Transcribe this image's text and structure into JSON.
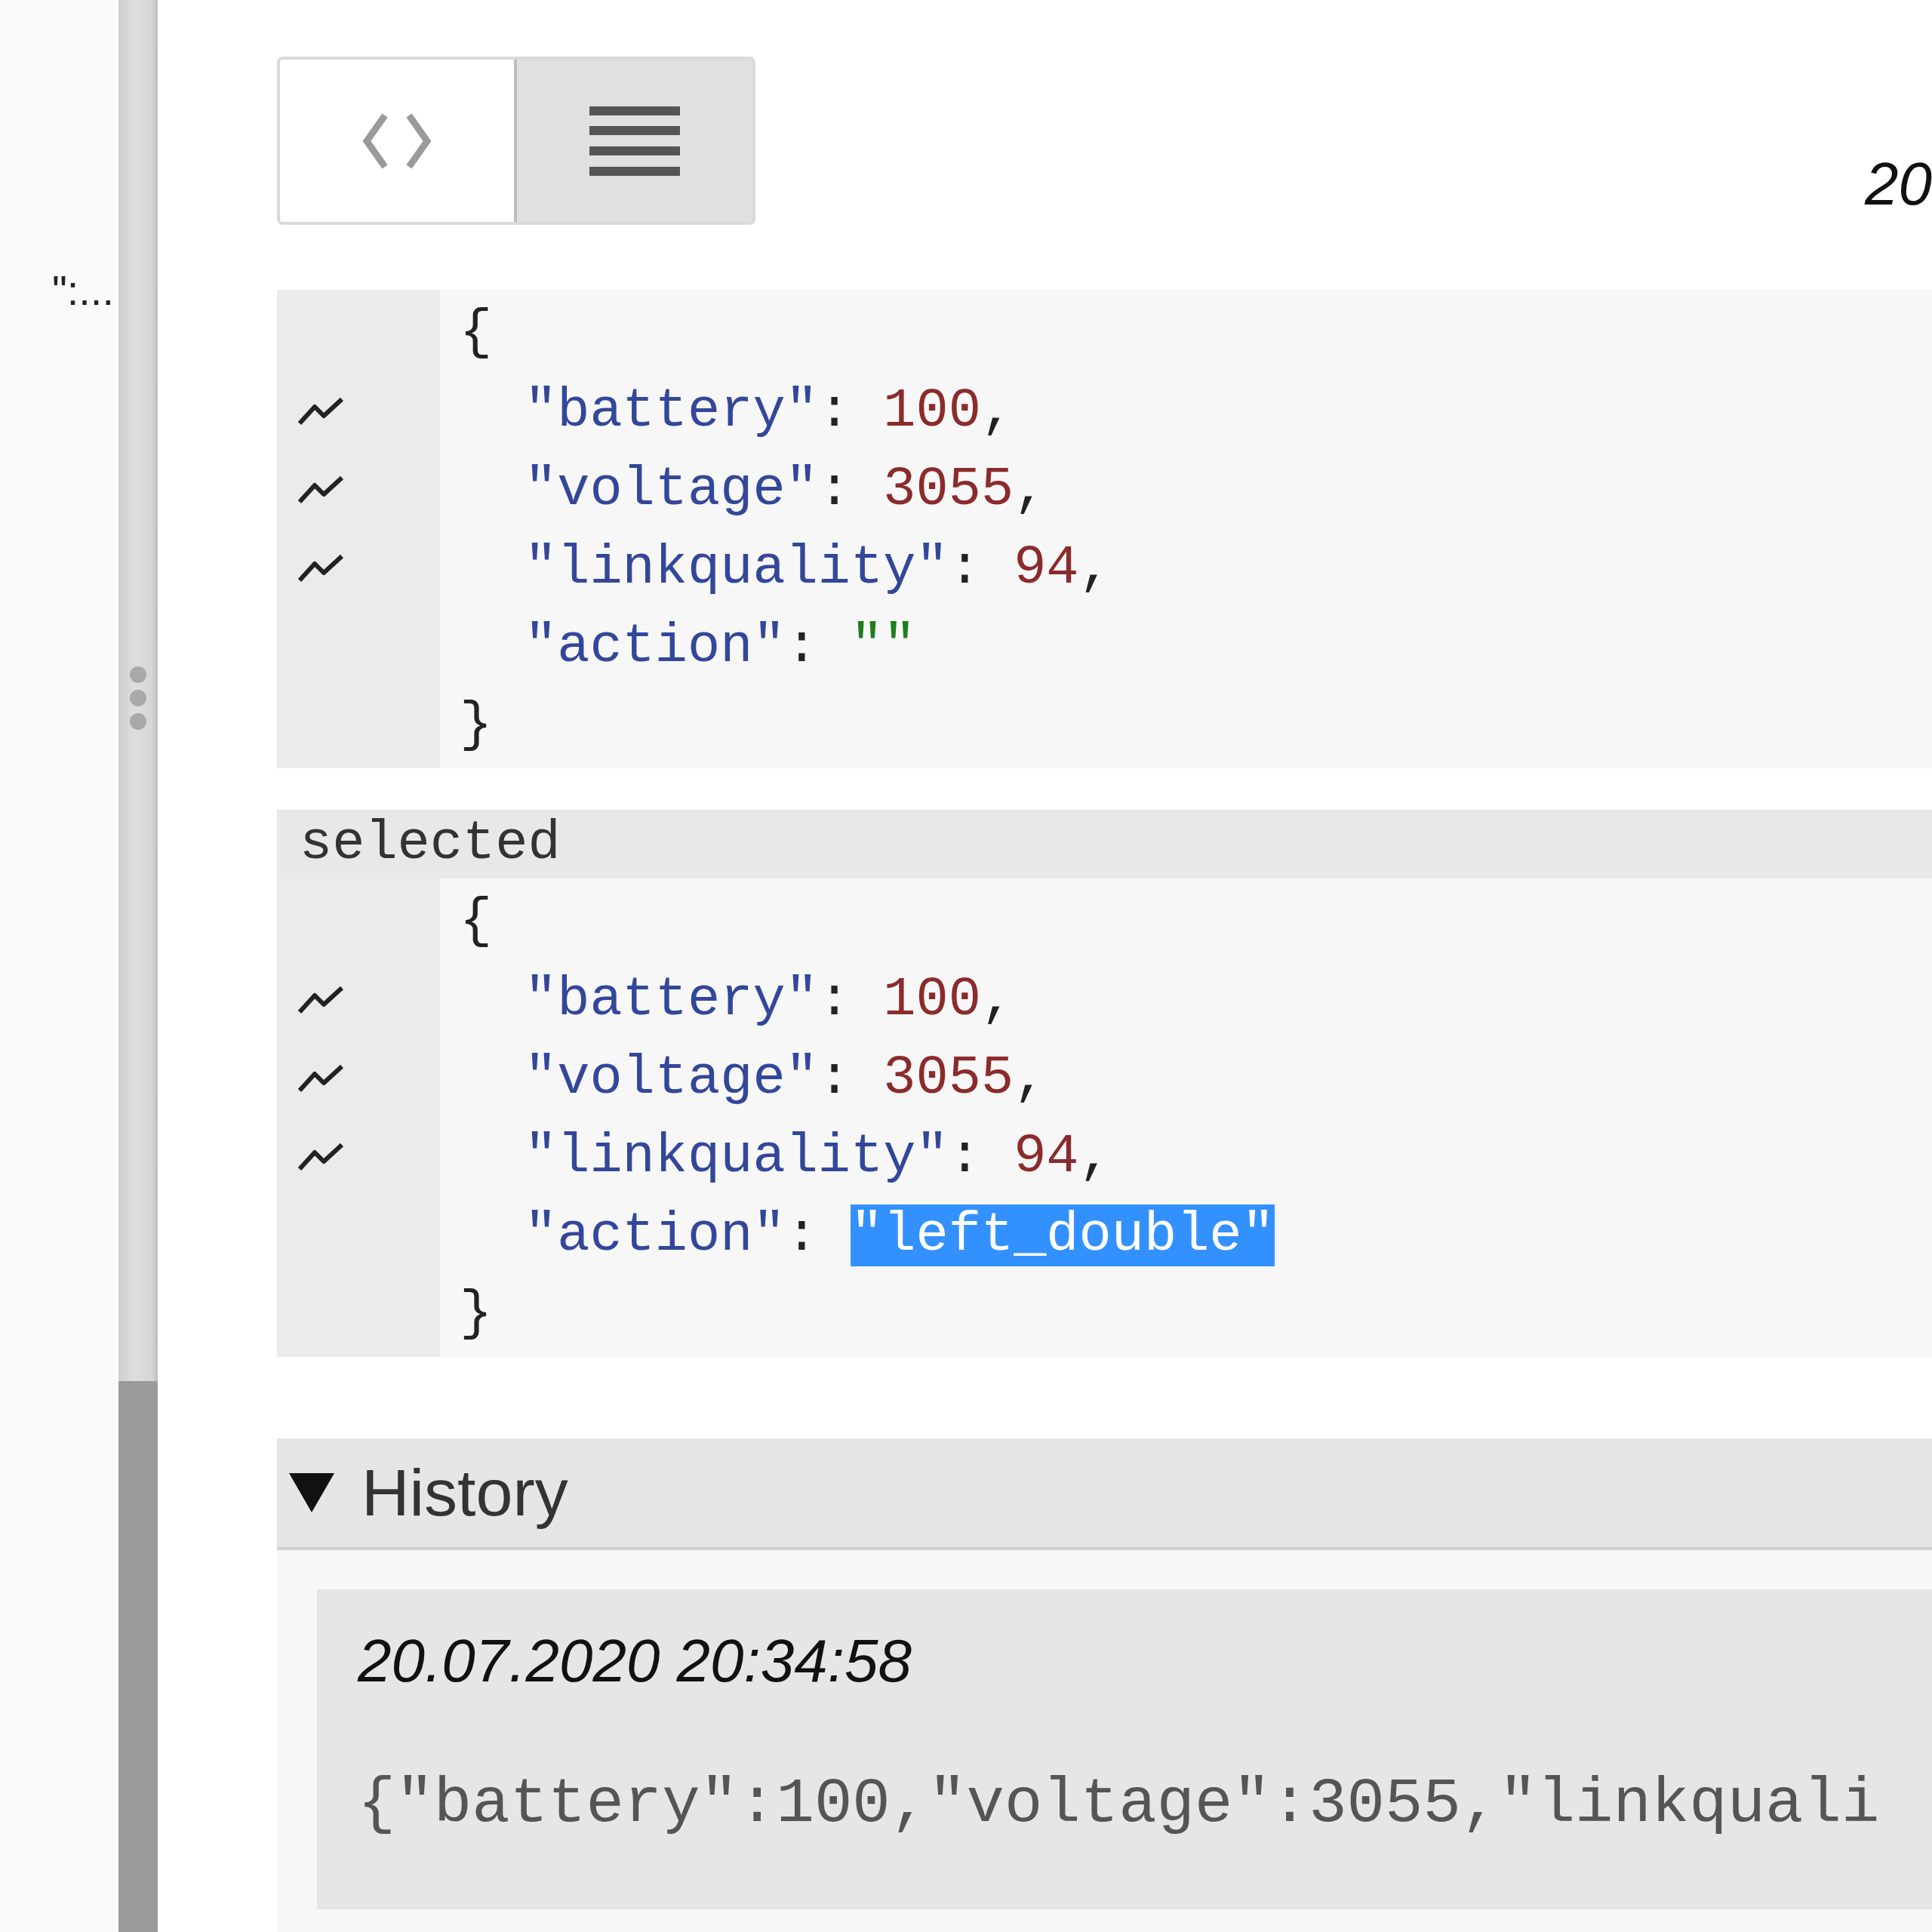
{
  "sidebar": {
    "text": "\":..."
  },
  "view_toggle": [
    {
      "kind": "code",
      "selected": false
    },
    {
      "kind": "list",
      "selected": true
    }
  ],
  "timestamp_header": "20",
  "payload": {
    "lines": [
      {
        "kind": "brace",
        "text": "{"
      },
      {
        "kind": "field",
        "chart": true,
        "key": "\"battery\"",
        "colon": ":",
        "value": {
          "kind": "number",
          "text": "100"
        },
        "comma": ",",
        "value_selected": false
      },
      {
        "kind": "field",
        "chart": true,
        "key": "\"voltage\"",
        "colon": ":",
        "value": {
          "kind": "number",
          "text": "3055"
        },
        "comma": ",",
        "value_selected": false
      },
      {
        "kind": "field",
        "chart": true,
        "key": "\"linkquality\"",
        "colon": ":",
        "value": {
          "kind": "number",
          "text": "94"
        },
        "comma": ",",
        "value_selected": false
      },
      {
        "kind": "field",
        "chart": false,
        "key": "\"action\"",
        "colon": ":",
        "value": {
          "kind": "string",
          "text": "\"\""
        },
        "value_selected": false
      },
      {
        "kind": "brace",
        "text": "}"
      }
    ]
  },
  "selected_section": {
    "title": "selected",
    "lines": [
      {
        "kind": "brace",
        "text": "{"
      },
      {
        "kind": "field",
        "chart": true,
        "key": "\"battery\"",
        "colon": ":",
        "value": {
          "kind": "number",
          "text": "100"
        },
        "comma": ",",
        "value_selected": false
      },
      {
        "kind": "field",
        "chart": true,
        "key": "\"voltage\"",
        "colon": ":",
        "value": {
          "kind": "number",
          "text": "3055"
        },
        "comma": ",",
        "value_selected": false
      },
      {
        "kind": "field",
        "chart": true,
        "key": "\"linkquality\"",
        "colon": ":",
        "value": {
          "kind": "number",
          "text": "94"
        },
        "comma": ",",
        "value_selected": false
      },
      {
        "kind": "field",
        "chart": false,
        "key": "\"action\"",
        "colon": ":",
        "value": {
          "kind": "string",
          "text": "\"left_double\""
        },
        "value_selected": true
      },
      {
        "kind": "brace",
        "text": "}"
      }
    ]
  },
  "history": {
    "title": "History",
    "expanded": true,
    "entries": [
      {
        "time": "20.07.2020 20:34:58",
        "payload": "{\"battery\":100,\"voltage\":3055,\"linkquali"
      }
    ]
  }
}
